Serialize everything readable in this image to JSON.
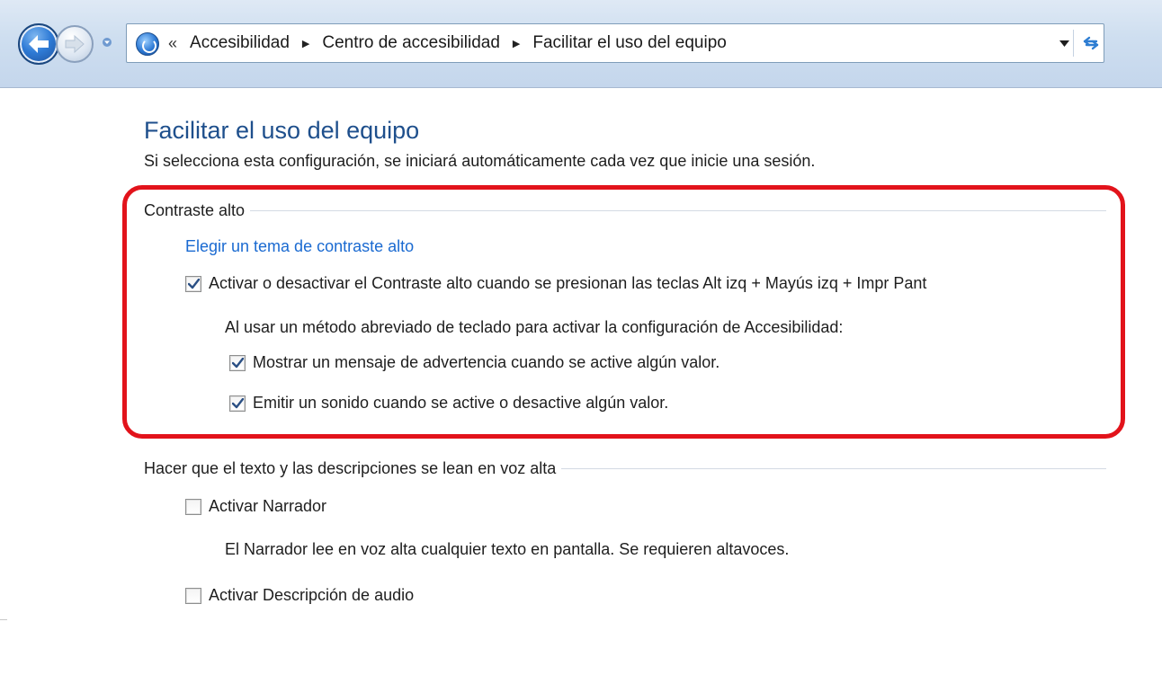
{
  "window": {
    "breadcrumb": {
      "overflow": "«",
      "items": [
        "Accesibilidad",
        "Centro de accesibilidad",
        "Facilitar el uso del equipo"
      ]
    },
    "icons": {
      "back": "back-arrow-icon",
      "forward": "forward-arrow-icon",
      "history": "chevron-down-icon",
      "address": "control-panel-icon",
      "address_dropdown": "chevron-down-icon",
      "refresh": "refresh-icon"
    }
  },
  "page": {
    "title": "Facilitar el uso del equipo",
    "subtitle": "Si selecciona esta configuración, se iniciará automáticamente cada vez que inicie una sesión."
  },
  "high_contrast": {
    "header": "Contraste alto",
    "theme_link": "Elegir un tema de contraste alto",
    "hotkey_toggle": {
      "label": "Activar o desactivar el Contraste alto cuando se presionan las teclas Alt izq + Mayús izq + Impr Pant",
      "checked": true
    },
    "shortcut_description": "Al usar un método abreviado de teclado para activar la configuración de Accesibilidad:",
    "warning_toggle": {
      "label": "Mostrar un mensaje de advertencia cuando se active algún valor.",
      "checked": true
    },
    "sound_toggle": {
      "label": "Emitir un sonido cuando se active o desactive algún valor.",
      "checked": true
    }
  },
  "read_aloud": {
    "header": "Hacer que el texto y las descripciones se lean en voz alta",
    "narrator_toggle": {
      "label": "Activar Narrador",
      "checked": false
    },
    "narrator_description": "El Narrador lee en voz alta cualquier texto en pantalla. Se requieren altavoces.",
    "audio_description_toggle": {
      "label": "Activar Descripción de audio",
      "checked": false
    }
  },
  "colors": {
    "title_blue": "#1e4f8c",
    "link_blue": "#1a6ad1",
    "highlight_red": "#e2131b"
  }
}
